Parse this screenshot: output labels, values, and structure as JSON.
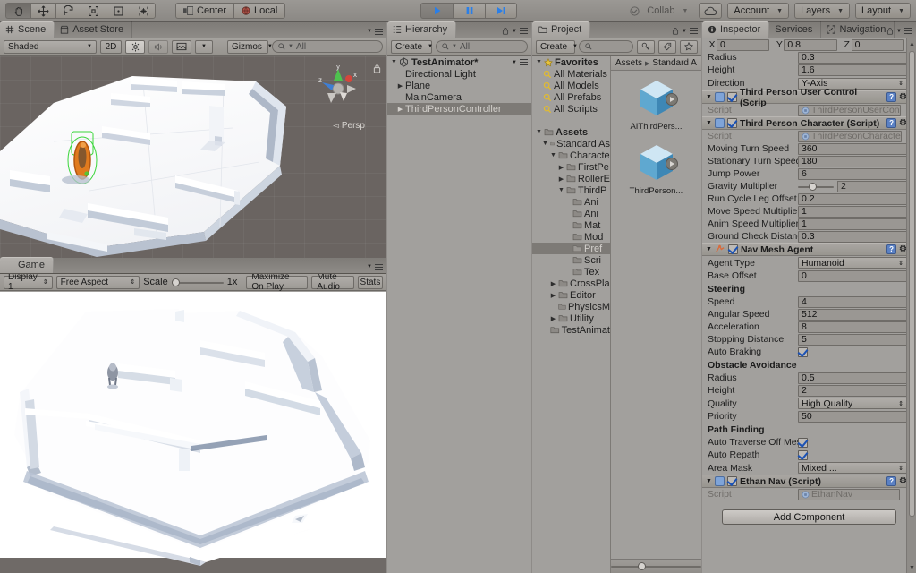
{
  "toolbar": {
    "tools": [
      {
        "name": "hand-tool",
        "active": true
      },
      {
        "name": "move-tool",
        "active": false
      },
      {
        "name": "rotate-tool",
        "active": false
      },
      {
        "name": "scale-tool",
        "active": false
      },
      {
        "name": "rect-tool",
        "active": false
      },
      {
        "name": "transform-tool",
        "active": false
      }
    ],
    "pivot_label": "Center",
    "space_label": "Local",
    "play_label": "play-icon",
    "pause_label": "pause-icon",
    "step_label": "step-icon",
    "collab_label": "Collab",
    "account_label": "Account",
    "layers_label": "Layers",
    "layout_label": "Layout"
  },
  "scene": {
    "tabs": [
      {
        "label": "Scene",
        "icon": "grid-icon",
        "active": true
      },
      {
        "label": "Asset Store",
        "icon": "store-icon",
        "active": false
      }
    ],
    "draw_mode": "Shaded",
    "mode_2d": "2D",
    "lighting_icon": "sun-icon",
    "audio_icon": "speaker-icon",
    "fx_icon": "image-icon",
    "gizmos_label": "Gizmos",
    "search_placeholder": "All",
    "persp_label": "Persp",
    "axis_x": "x",
    "axis_y": "y",
    "axis_z": "z"
  },
  "game": {
    "tabs": [
      {
        "label": "Game",
        "icon": "game-icon",
        "active": true
      }
    ],
    "display": "Display 1",
    "aspect": "Free Aspect",
    "scale_label": "Scale",
    "scale_value": "1x",
    "maximize_label": "Maximize On Play",
    "mute_label": "Mute Audio",
    "stats_label": "Stats"
  },
  "hierarchy": {
    "tab_label": "Hierarchy",
    "create_label": "Create",
    "search_placeholder": "All",
    "items": [
      {
        "label": "TestAnimator*",
        "depth": 0,
        "arrow": "down",
        "selected": false,
        "scene": true
      },
      {
        "label": "Directional Light",
        "depth": 1,
        "arrow": "",
        "selected": false
      },
      {
        "label": "Plane",
        "depth": 1,
        "arrow": "right",
        "selected": false
      },
      {
        "label": "MainCamera",
        "depth": 1,
        "arrow": "",
        "selected": false
      },
      {
        "label": "ThirdPersonController",
        "depth": 1,
        "arrow": "right",
        "selected": true
      }
    ]
  },
  "project": {
    "tab_label": "Project",
    "create_label": "Create",
    "search_placeholder": "",
    "breadcrumb": [
      "Assets",
      "Standard A"
    ],
    "tree": [
      {
        "label": "Favorites",
        "depth": 0,
        "arrow": "down",
        "icon": "star",
        "bold": true
      },
      {
        "label": "All Materials",
        "depth": 1,
        "arrow": "",
        "icon": "search"
      },
      {
        "label": "All Models",
        "depth": 1,
        "arrow": "",
        "icon": "search"
      },
      {
        "label": "All Prefabs",
        "depth": 1,
        "arrow": "",
        "icon": "search"
      },
      {
        "label": "All Scripts",
        "depth": 1,
        "arrow": "",
        "icon": "search"
      },
      {
        "label": "",
        "depth": 0,
        "arrow": "",
        "icon": "none"
      },
      {
        "label": "Assets",
        "depth": 0,
        "arrow": "down",
        "icon": "folder",
        "bold": true
      },
      {
        "label": "Standard As",
        "depth": 1,
        "arrow": "down",
        "icon": "folder"
      },
      {
        "label": "Characte",
        "depth": 2,
        "arrow": "down",
        "icon": "folder"
      },
      {
        "label": "FirstPe",
        "depth": 3,
        "arrow": "right",
        "icon": "folder"
      },
      {
        "label": "RollerE",
        "depth": 3,
        "arrow": "right",
        "icon": "folder"
      },
      {
        "label": "ThirdP",
        "depth": 3,
        "arrow": "down",
        "icon": "folder"
      },
      {
        "label": "Ani",
        "depth": 4,
        "arrow": "",
        "icon": "folder"
      },
      {
        "label": "Ani",
        "depth": 4,
        "arrow": "",
        "icon": "folder"
      },
      {
        "label": "Mat",
        "depth": 4,
        "arrow": "",
        "icon": "folder"
      },
      {
        "label": "Mod",
        "depth": 4,
        "arrow": "",
        "icon": "folder"
      },
      {
        "label": "Pref",
        "depth": 4,
        "arrow": "",
        "icon": "folder",
        "selected": true
      },
      {
        "label": "Scri",
        "depth": 4,
        "arrow": "",
        "icon": "folder"
      },
      {
        "label": "Tex",
        "depth": 4,
        "arrow": "",
        "icon": "folder"
      },
      {
        "label": "CrossPla",
        "depth": 2,
        "arrow": "right",
        "icon": "folder"
      },
      {
        "label": "Editor",
        "depth": 2,
        "arrow": "right",
        "icon": "folder"
      },
      {
        "label": "PhysicsM",
        "depth": 2,
        "arrow": "",
        "icon": "folder"
      },
      {
        "label": "Utility",
        "depth": 2,
        "arrow": "right",
        "icon": "folder"
      },
      {
        "label": "TestAnimat",
        "depth": 1,
        "arrow": "",
        "icon": "folder"
      }
    ],
    "assets": [
      {
        "label": "AIThirdPers...",
        "icon": "prefab-cube"
      },
      {
        "label": "ThirdPerson...",
        "icon": "prefab-cube"
      }
    ]
  },
  "inspector": {
    "tabs": [
      {
        "label": "Inspector",
        "icon": "info-icon",
        "active": true
      },
      {
        "label": "Services",
        "icon": "",
        "active": false
      },
      {
        "label": "Navigation",
        "icon": "nav-icon",
        "active": false
      }
    ],
    "center": {
      "x_label": "X",
      "x": "0",
      "y_label": "Y",
      "y": "0.8",
      "z_label": "Z",
      "z": "0"
    },
    "capsule": [
      {
        "label": "Radius",
        "value": "0.3",
        "type": "text"
      },
      {
        "label": "Height",
        "value": "1.6",
        "type": "text"
      },
      {
        "label": "Direction",
        "value": "Y-Axis",
        "type": "dropdown"
      }
    ],
    "components": [
      {
        "title": "Third Person User Control (Scrip",
        "enabled": true,
        "icon_color": "#7fa4d8",
        "rows": [
          {
            "label": "Script",
            "value": "ThirdPersonUserCon",
            "type": "object",
            "disabled": true
          }
        ]
      },
      {
        "title": "Third Person Character (Script)",
        "enabled": true,
        "icon_color": "#7fa4d8",
        "rows": [
          {
            "label": "Script",
            "value": "ThirdPersonCharacte",
            "type": "object",
            "disabled": true
          },
          {
            "label": "Moving Turn Speed",
            "value": "360",
            "type": "text"
          },
          {
            "label": "Stationary Turn Speed",
            "value": "180",
            "type": "text"
          },
          {
            "label": "Jump Power",
            "value": "6",
            "type": "text"
          },
          {
            "label": "Gravity Multiplier",
            "value": "2",
            "type": "slider",
            "slider_pct": 30
          },
          {
            "label": "Run Cycle Leg Offset",
            "value": "0.2",
            "type": "text"
          },
          {
            "label": "Move Speed Multiplier",
            "value": "1",
            "type": "text"
          },
          {
            "label": "Anim Speed Multiplier",
            "value": "1",
            "type": "text"
          },
          {
            "label": "Ground Check Distanc",
            "value": "0.3",
            "type": "text"
          }
        ]
      },
      {
        "title": "Nav Mesh Agent",
        "enabled": true,
        "icon_color": "#d96b3c",
        "rows": [
          {
            "label": "Agent Type",
            "value": "Humanoid",
            "type": "dropdown"
          },
          {
            "label": "Base Offset",
            "value": "0",
            "type": "text"
          },
          {
            "label": "Steering",
            "type": "section"
          },
          {
            "label": "Speed",
            "value": "4",
            "type": "text"
          },
          {
            "label": "Angular Speed",
            "value": "512",
            "type": "text"
          },
          {
            "label": "Acceleration",
            "value": "8",
            "type": "text"
          },
          {
            "label": "Stopping Distance",
            "value": "5",
            "type": "text"
          },
          {
            "label": "Auto Braking",
            "value": true,
            "type": "checkbox"
          },
          {
            "label": "Obstacle Avoidance",
            "type": "section"
          },
          {
            "label": "Radius",
            "value": "0.5",
            "type": "text"
          },
          {
            "label": "Height",
            "value": "2",
            "type": "text"
          },
          {
            "label": "Quality",
            "value": "High Quality",
            "type": "dropdown"
          },
          {
            "label": "Priority",
            "value": "50",
            "type": "text"
          },
          {
            "label": "Path Finding",
            "type": "section"
          },
          {
            "label": "Auto Traverse Off Mes",
            "value": true,
            "type": "checkbox"
          },
          {
            "label": "Auto Repath",
            "value": true,
            "type": "checkbox"
          },
          {
            "label": "Area Mask",
            "value": "Mixed ...",
            "type": "dropdown"
          }
        ]
      },
      {
        "title": "Ethan Nav (Script)",
        "enabled": true,
        "icon_color": "#7fa4d8",
        "rows": [
          {
            "label": "Script",
            "value": "EthanNav",
            "type": "object",
            "disabled": true
          }
        ]
      }
    ],
    "add_component_label": "Add Component"
  },
  "colors": {
    "accent_blue": "#2a7fe8",
    "panel_bg": "#a2a09d",
    "chrome_bg": "#8e8b88",
    "selection": "#7d7a76"
  }
}
